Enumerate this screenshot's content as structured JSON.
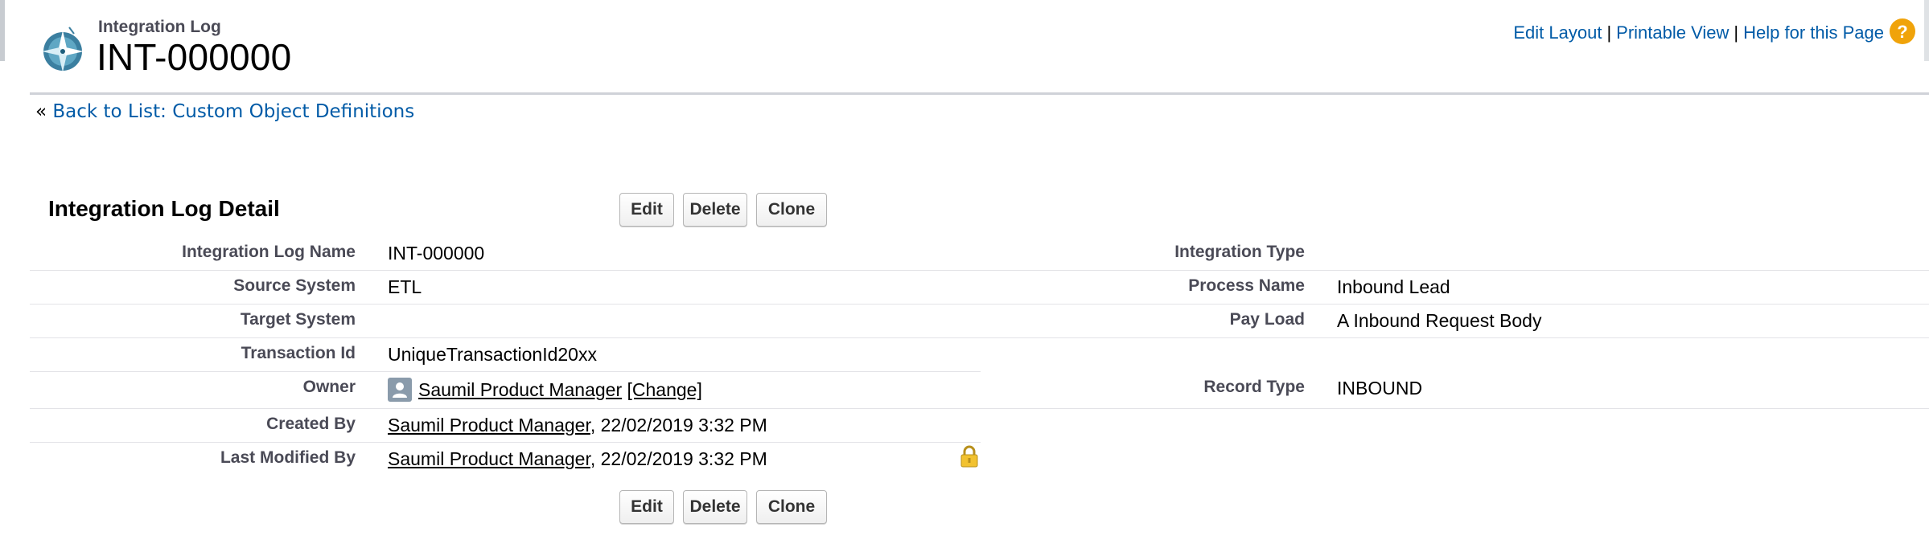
{
  "header": {
    "object_name": "Integration Log",
    "record_name": "INT-000000",
    "links": {
      "edit_layout": "Edit Layout",
      "printable_view": "Printable View",
      "help": "Help for this Page",
      "separator": "|"
    },
    "icons": {
      "object": "compass-icon",
      "help": "help-icon"
    }
  },
  "back_link": {
    "prefix": "«",
    "label": "Back to List: Custom Object Definitions"
  },
  "detail": {
    "title": "Integration Log Detail",
    "buttons": {
      "edit": "Edit",
      "delete": "Delete",
      "clone": "Clone"
    },
    "left_fields": [
      {
        "label": "Integration Log Name",
        "value": "INT-000000"
      },
      {
        "label": "Source System",
        "value": "ETL"
      },
      {
        "label": "Target System",
        "value": ""
      },
      {
        "label": "Transaction Id",
        "value": "UniqueTransactionId20xx"
      },
      {
        "label": "Owner",
        "value": "Saumil Product Manager",
        "extra": "[Change]"
      },
      {
        "label": "Created By",
        "value": "Saumil Product Manager",
        "extra": ", 22/02/2019 3:32 PM"
      },
      {
        "label": "Last Modified By",
        "value": "Saumil Product Manager",
        "extra": ", 22/02/2019 3:32 PM"
      }
    ],
    "right_fields": [
      {
        "label": "Integration Type",
        "value": ""
      },
      {
        "label": "Process Name",
        "value": "Inbound Lead"
      },
      {
        "label": "Pay Load",
        "value": "A Inbound Request Body"
      },
      {
        "label": "Record Type",
        "value": "INBOUND"
      }
    ]
  },
  "colors": {
    "link": "#015ba7",
    "label": "#4a4a56",
    "rule": "#cfd2d8",
    "help": "#f0a30a"
  }
}
